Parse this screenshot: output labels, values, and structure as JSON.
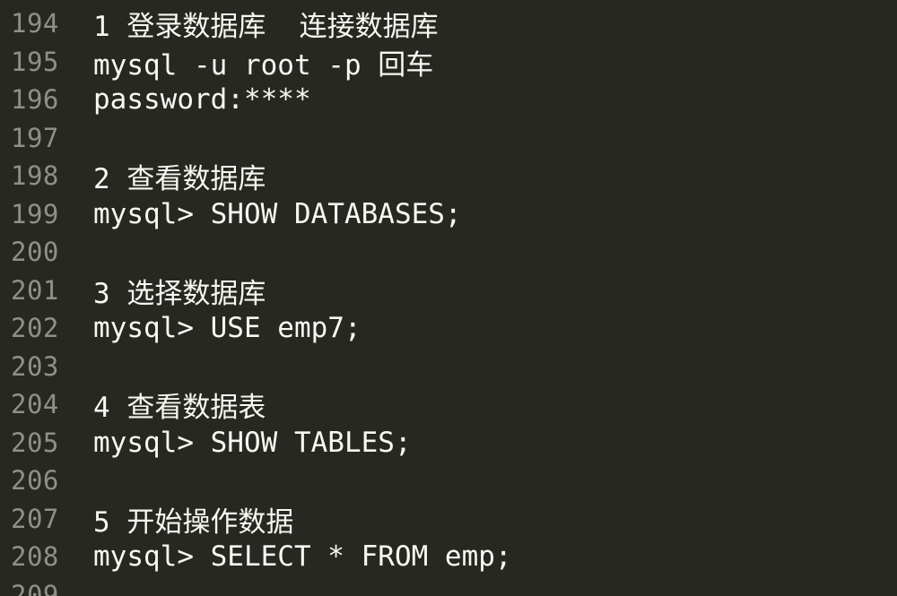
{
  "editor": {
    "colors": {
      "background": "#272822",
      "gutter_text": "#8f908a",
      "code_text": "#f8f8f2"
    },
    "lines": [
      {
        "number": "194",
        "text": "1 登录数据库  连接数据库"
      },
      {
        "number": "195",
        "text": "mysql -u root -p 回车"
      },
      {
        "number": "196",
        "text": "password:****"
      },
      {
        "number": "197",
        "text": ""
      },
      {
        "number": "198",
        "text": "2 查看数据库"
      },
      {
        "number": "199",
        "text": "mysql> SHOW DATABASES;"
      },
      {
        "number": "200",
        "text": ""
      },
      {
        "number": "201",
        "text": "3 选择数据库"
      },
      {
        "number": "202",
        "text": "mysql> USE emp7;"
      },
      {
        "number": "203",
        "text": ""
      },
      {
        "number": "204",
        "text": "4 查看数据表"
      },
      {
        "number": "205",
        "text": "mysql> SHOW TABLES;"
      },
      {
        "number": "206",
        "text": ""
      },
      {
        "number": "207",
        "text": "5 开始操作数据"
      },
      {
        "number": "208",
        "text": "mysql> SELECT * FROM emp;"
      },
      {
        "number": "209",
        "text": ""
      }
    ]
  }
}
